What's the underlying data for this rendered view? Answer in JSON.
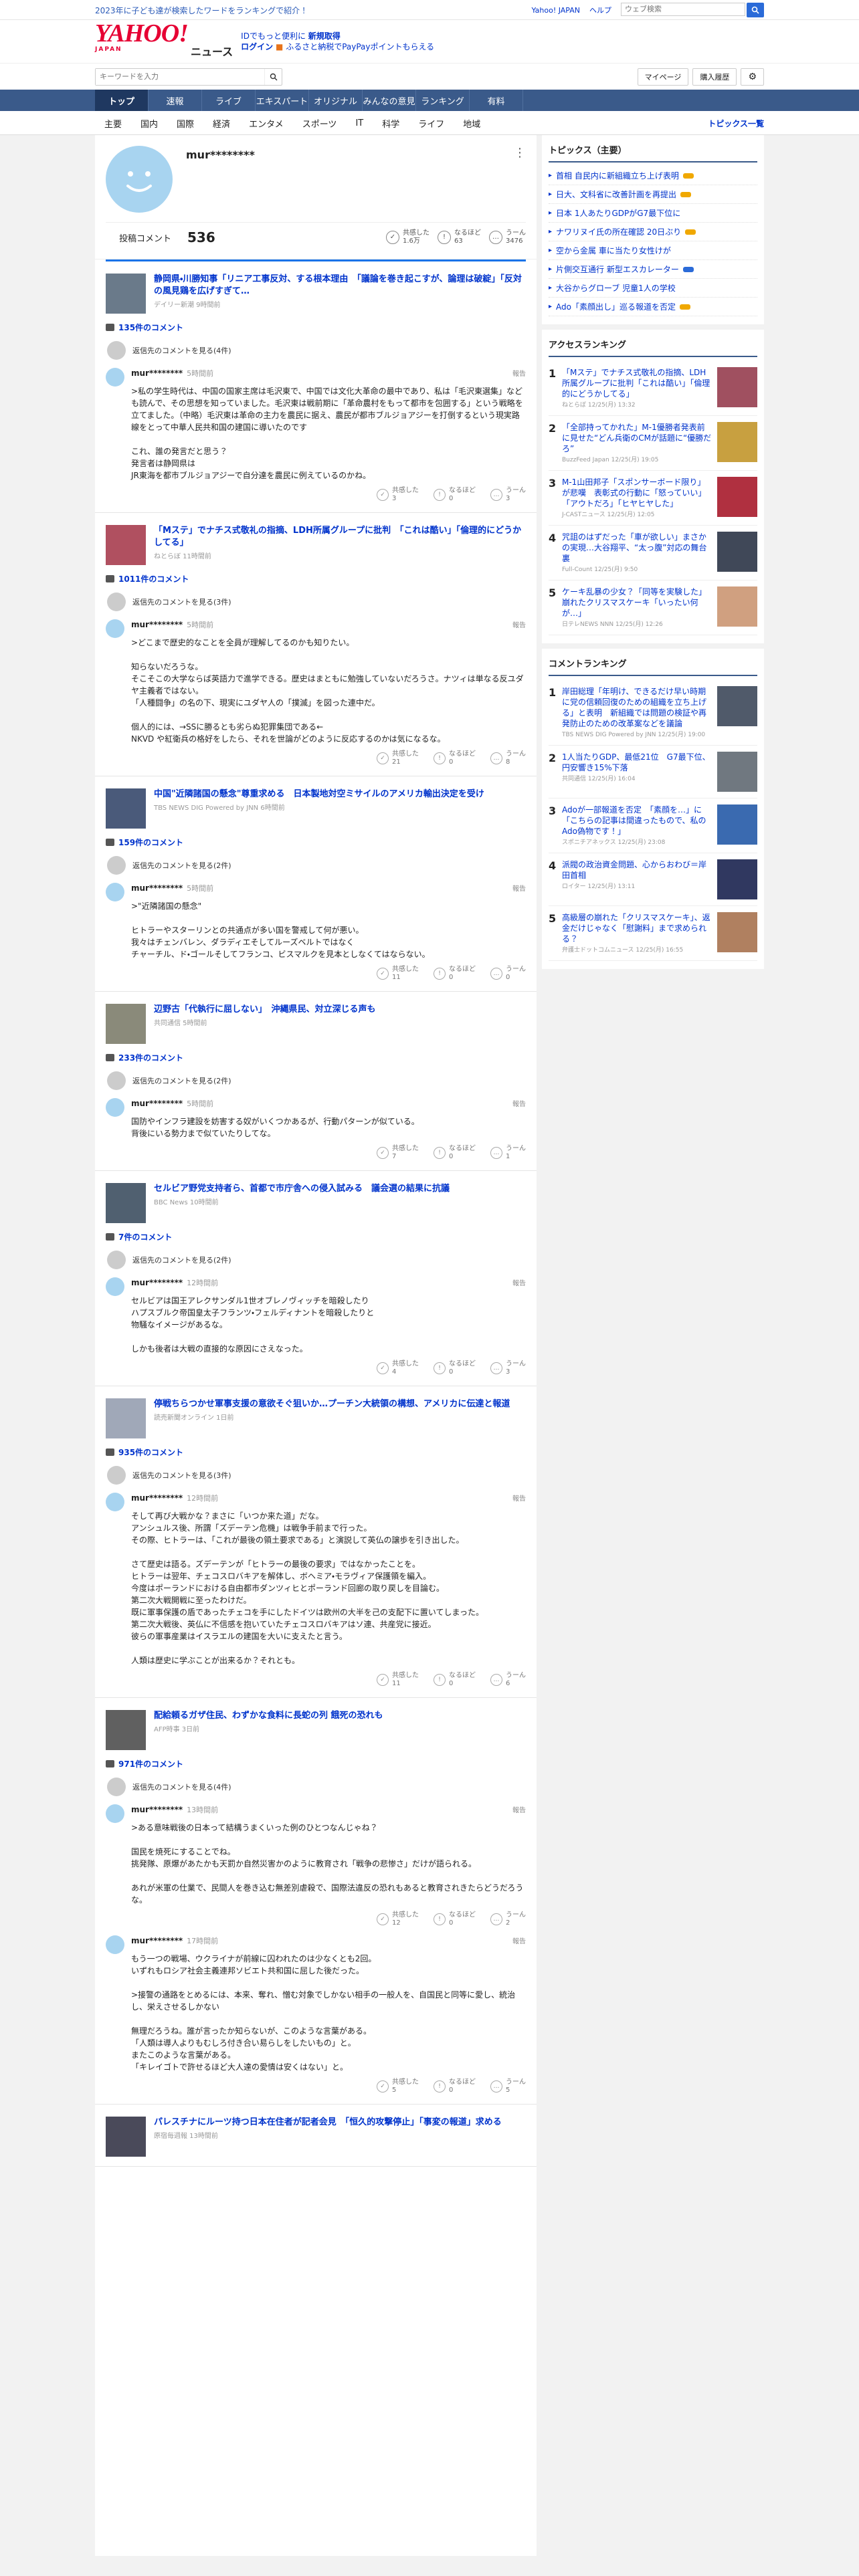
{
  "topbar": {
    "promo": "2023年に子ども達が検索したワードをランキングで紹介！",
    "link1": "Yahoo! JAPAN",
    "link2": "ヘルプ",
    "search_placeholder": "ウェブ検索"
  },
  "header": {
    "logo": "YAHOO!",
    "logo_sub": "JAPAN",
    "section": "ニュース",
    "promo_line1": "IDでもっと便利に",
    "promo_line1_link": "新規取得",
    "promo_line2_link": "ログイン",
    "promo_line2_text": "ふるさと納税でPayPayポイントもらえる"
  },
  "search": {
    "placeholder": "キーワードを入力",
    "mypage": "マイページ",
    "purchased": "購入履歴"
  },
  "nav": {
    "tabs": [
      "トップ",
      "速報",
      "ライブ",
      "エキスパート",
      "オリジナル",
      "みんなの意見",
      "ランキング",
      "有料"
    ]
  },
  "subnav": {
    "cats": [
      "主要",
      "国内",
      "国際",
      "経済",
      "エンタメ",
      "スポーツ",
      "IT",
      "科学",
      "ライフ",
      "地域"
    ],
    "all": "トピックス一覧"
  },
  "profile": {
    "name": "mur********",
    "comments_label": "投稿コメント",
    "comments_count": "536",
    "empathy_label": "共感した",
    "empathy_val": "1.6万",
    "naruhodo_label": "なるほど",
    "naruhodo_val": "63",
    "uun_label": "うーん",
    "uun_val": "3476"
  },
  "colors": {
    "accent": "#0033cc",
    "nav": "#3a5a8a",
    "avatar": "#a8d4f0"
  },
  "articles": [
    {
      "title": "静岡県・川勝知事「リニア工事反対、する根本理由　「議論を巻き起こすが、論理は破綻」「反対の風見鶏を広げすぎて…",
      "src": "デイリー新潮 9時間前",
      "count": "135件のコメント",
      "reply": "返信先のコメントを見る(4件)",
      "comments": [
        {
          "user": "mur********",
          "ago": "5時間前",
          "text": ">私の学生時代は、中国の国家主席は毛沢東で、中国では文化大革命の最中であり、私は「毛沢東選集」なども読んで、その思想を知っていました。毛沢東は戦前期に「革命農村をもって都市を包囲する」という戦略を立てました。（中略）毛沢東は革命の主力を農民に据え、農民が都市ブルジョアジーを打倒するという現実路線をとって中華人民共和国の建国に導いたのです\n\nこれ、誰の発言だと思う？\n発言者は静岡県は\nJR東海を都市ブルジョアジーで自分達を農民に例えているのかね。",
          "e": "3",
          "n": "0",
          "u": "3"
        }
      ]
    },
    {
      "title": "「Mステ」でナチス式敬礼の指摘、LDH所属グループに批判　「これは酷い」「倫理的にどうかしてる」",
      "src": "ねとらぼ 11時間前",
      "count": "1011件のコメント",
      "reply": "返信先のコメントを見る(3件)",
      "comments": [
        {
          "user": "mur********",
          "ago": "5時間前",
          "text": ">どこまで歴史的なことを全員が理解してるのかも知りたい。\n\n知らないだろうな。\nそこそこの大学ならば英語力で進学できる。歴史はまともに勉強していないだろうさ。ナツィは単なる反ユダヤ主義者ではない。\n「人種闘争」の名の下、現実にユダヤ人の「撲滅」を図った連中だ。\n\n個人的には、→SSに勝るとも劣らぬ犯罪集団である←\nNKVD や紅衛兵の格好をしたら、それを世論がどのように反応するのかは気になるな。",
          "e": "21",
          "n": "0",
          "u": "8"
        }
      ]
    },
    {
      "title": "中国\"近隣諸国の懸念\"尊重求める　日本製地対空ミサイルのアメリカ輸出決定を受け",
      "src": "TBS NEWS DIG Powered by JNN 6時間前",
      "count": "159件のコメント",
      "reply": "返信先のコメントを見る(2件)",
      "comments": [
        {
          "user": "mur********",
          "ago": "5時間前",
          "text": ">\"近隣諸国の懸念\"\n\nヒトラーやスターリンとの共通点が多い国を警戒して何が悪い。\n我々はチェンバレン、ダラディエそしてルーズベルトではなく\nチャーチル、ド・ゴールそしてフランコ、ビスマルクを見本としなくてはならない。",
          "e": "11",
          "n": "0",
          "u": "0"
        }
      ]
    },
    {
      "title": "辺野古「代執行に屈しない」　沖縄県民、対立深じる声も",
      "src": "共同通信 5時間前",
      "count": "233件のコメント",
      "reply": "返信先のコメントを見る(2件)",
      "comments": [
        {
          "user": "mur********",
          "ago": "5時間前",
          "text": "国防やインフラ建設を妨害する奴がいくつかあるが、行動パターンが似ている。\n背後にいる勢力まで似ていたりしてな。",
          "e": "7",
          "n": "0",
          "u": "1"
        }
      ]
    },
    {
      "title": "セルビア野党支持者ら、首都で市庁舎への侵入試みる　議会選の結果に抗議",
      "src": "BBC News 10時間前",
      "count": "7件のコメント",
      "reply": "返信先のコメントを見る(2件)",
      "comments": [
        {
          "user": "mur********",
          "ago": "12時間前",
          "text": "セルビアは国王アレクサンダル1世オブレノヴィッチを暗殺したり\nハプスブルク帝国皇太子フランツ・フェルディナントを暗殺したりと\n物騒なイメージがあるな。\n\nしかも後者は大戦の直接的な原因にさえなった。",
          "e": "4",
          "n": "0",
          "u": "3"
        }
      ]
    },
    {
      "title": "停戦ちらつかせ軍事支援の意欲そぐ狙いか…プーチン大統領の構想、アメリカに伝達と報道",
      "src": "読売新聞オンライン 1日前",
      "count": "935件のコメント",
      "reply": "返信先のコメントを見る(3件)",
      "comments": [
        {
          "user": "mur********",
          "ago": "12時間前",
          "text": "そして再び大戦かな？まさに「いつか来た道」だな。\nアンシュルス後、所謂「ズデーテン危機」は戦争手前まで行った。\nその際、ヒトラーは、「これが最後の領土要求である」と演説して英仏の譲歩を引き出した。\n\nさて歴史は語る。ズデーテンが「ヒトラーの最後の要求」ではなかったことを。\nヒトラーは翌年、チェコスロバキアを解体し、ボヘミア・モラヴィア保護領を編入。\n今度はポーランドにおける自由都市ダンツィヒとポーランド回廊の取り戻しを目論む。\n第二次大戦開戦に至ったわけだ。\n既に軍事保護の盾であったチェコを手にしたドイツは欧州の大半を己の支配下に置いてしまった。\n第二次大戦後、英仏に不信感を抱いていたチェコスロバキアはソ連、共産党に接近。\n彼らの軍事産業はイスラエルの建国を大いに支えたと言う。\n\n人類は歴史に学ぶことが出来るか？それとも。",
          "e": "11",
          "n": "0",
          "u": "6"
        }
      ]
    },
    {
      "title": "配給頼るガザ住民、わずかな食料に長蛇の列 餓死の恐れも",
      "src": "AFP時事 3日前",
      "count": "971件のコメント",
      "reply": "返信先のコメントを見る(4件)",
      "comments": [
        {
          "user": "mur********",
          "ago": "13時間前",
          "text": ">ある意味戦後の日本って結構うまくいった例のひとつなんじゃね？\n\n国民を焼死にすることでね。\n挑発隊、原爆があたかも天罰か自然災害かのように教育され「戦争の悲惨さ」だけが語られる。\n\nあれが米軍の仕業で、民間人を巻き込む無差別虐殺で、国際法違反の恐れもあると教育されきたらどうだろうな。",
          "e": "12",
          "n": "0",
          "u": "2"
        },
        {
          "user": "mur********",
          "ago": "17時間前",
          "text": "もう一つの戦場、ウクライナが前線に囚われたのは少なくとも2回。\nいずれもロシア社会主義連邦ソビエト共和国に屈した後だった。\n\n>接警の通路をとめるには、本来、奪れ、憎む対象でしかない相手の一般人を、自国民と同等に愛し、統治し、栄えさせるしかない\n\n無理だろうね。誰が言ったか知らないが、このような言葉がある。\n「人類は導人よりもむしろ付き合い易らしをしたいもの」と。\nまたこのような言葉がある。\n「キレイゴトで許せるほど大人達の愛情は安くはない」と。",
          "e": "5",
          "n": "0",
          "u": "5"
        }
      ]
    },
    {
      "title": "パレスチナにルーツ持つ日本在住者が記者会見　「恒久的攻撃停止」「事変の報道」求める",
      "src": "原宿毎週報 13時間前",
      "count": "",
      "reply": "",
      "comments": []
    }
  ],
  "report_label": "報告",
  "act_labels": {
    "e": "共感した",
    "n": "なるほど",
    "u": "うーん"
  },
  "topics": {
    "heading": "トピックス（主要）",
    "items": [
      {
        "text": "首相 自民内に新組織立ち上げ表明",
        "badge": "new"
      },
      {
        "text": "日大、文科省に改善計画を再提出",
        "badge": "new"
      },
      {
        "text": "日本 1人あたりGDPがG7最下位に",
        "badge": ""
      },
      {
        "text": "ナワリヌイ氏の所在確認 20日ぶり",
        "badge": "new"
      },
      {
        "text": "空から金属 車に当たり女性けが",
        "badge": ""
      },
      {
        "text": "片側交互通行 新型エスカレーター",
        "badge": "photo"
      },
      {
        "text": "大谷からグローブ 児童1人の学校",
        "badge": ""
      },
      {
        "text": "Ado「素顔出し」巡る報道を否定",
        "badge": "new"
      }
    ]
  },
  "access": {
    "heading": "アクセスランキング",
    "items": [
      {
        "n": "1",
        "t": "「Mステ」でナチス式敬礼の指摘、LDH所属グループに批判「これは酷い」「倫理的にどうかしてる」",
        "s": "ねとらぼ 12/25(月) 13:32"
      },
      {
        "n": "2",
        "t": "「全部持ってかれた」M-1優勝者発表前に見せた“どん兵衛のCMが話題に“優勝だろ”",
        "s": "BuzzFeed Japan 12/25(月) 19:05"
      },
      {
        "n": "3",
        "t": "M-1山田邦子「スポンサーボード限り」が悲嘆　表彰式の行動に「怒っていい」「アウトだろ」「ヒヤヒヤした」",
        "s": "J-CASTニュース 12/25(月) 12:05"
      },
      {
        "n": "4",
        "t": "咒詛のはずだった「車が欲しい」まさかの実現…大谷翔平、“太っ腹”対応の舞台裏",
        "s": "Full-Count 12/25(月) 9:50"
      },
      {
        "n": "5",
        "t": "ケーキ乱暴の少女？「同等を実験した」　崩れたクリスマスケーキ「いったい何が…」",
        "s": "日テレNEWS NNN 12/25(月) 12:26"
      }
    ]
  },
  "comment_rank": {
    "heading": "コメントランキング",
    "items": [
      {
        "n": "1",
        "t": "岸田総理「年明け、できるだけ早い時期に党の信頼回復のための組織を立ち上げる」と表明　新組織では問題の検証や再発防止のための改革案などを議論",
        "s": "TBS NEWS DIG Powered by JNN 12/25(月) 19:00"
      },
      {
        "n": "2",
        "t": "1人当たりGDP、最低21位　G7最下位、円安響き15%下落",
        "s": "共同通信 12/25(月) 16:04"
      },
      {
        "n": "3",
        "t": "Adoが一部報道を否定　「素顔を…」に「こちらの記事は間違ったもので、私のAdo偽物です！」",
        "s": "スポニチアネックス 12/25(月) 23:08"
      },
      {
        "n": "4",
        "t": "派閥の政治資金問題、心からおわび＝岸田首相",
        "s": "ロイター 12/25(月) 13:11"
      },
      {
        "n": "5",
        "t": "高級層の崩れた「クリスマスケーキ」、返金だけじゃなく「慰謝料」まで求められる？",
        "s": "弁護士ドットコムニュース 12/25(月) 16:55"
      }
    ]
  }
}
